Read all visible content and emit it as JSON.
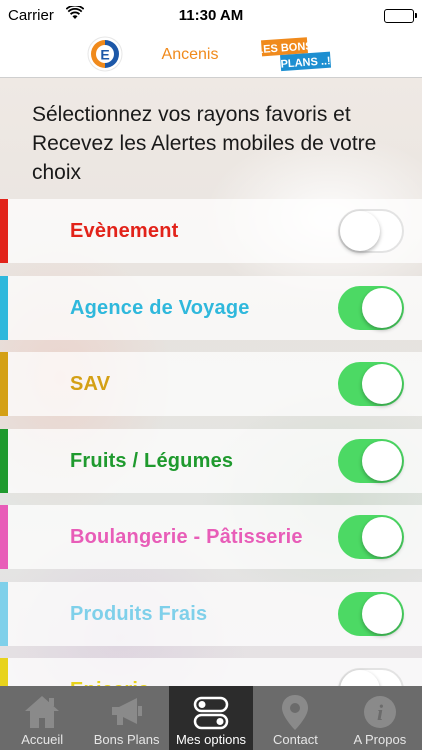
{
  "status_bar": {
    "carrier": "Carrier",
    "time": "11:30 AM"
  },
  "header": {
    "store_name": "Ancenis",
    "logo_icon": "leclerc-e-logo",
    "bons_plans_logo_text": "LES BONS PLANS ..!"
  },
  "intro_text": "Sélectionnez vos rayons favoris et Recevez les Alertes mobiles de votre choix",
  "rows": [
    {
      "label": "Evènement",
      "color": "#e2231a",
      "enabled": false
    },
    {
      "label": "Agence de Voyage",
      "color": "#2fb8dc",
      "enabled": true
    },
    {
      "label": "SAV",
      "color": "#d4a015",
      "enabled": true
    },
    {
      "label": "Fruits / Légumes",
      "color": "#1f9a2e",
      "enabled": true
    },
    {
      "label": "Boulangerie - Pâtisserie",
      "color": "#e85db8",
      "enabled": true
    },
    {
      "label": "Produits Frais",
      "color": "#7fd0ea",
      "enabled": true
    },
    {
      "label": "Epicerie",
      "color": "#e8d31c",
      "enabled": false
    }
  ],
  "tabs": [
    {
      "label": "Accueil",
      "icon": "home-icon",
      "active": false
    },
    {
      "label": "Bons Plans",
      "icon": "megaphone-icon",
      "active": false
    },
    {
      "label": "Mes options",
      "icon": "toggles-icon",
      "active": true
    },
    {
      "label": "Contact",
      "icon": "location-pin-icon",
      "active": false
    },
    {
      "label": "A Propos",
      "icon": "info-icon",
      "active": false
    }
  ],
  "colors": {
    "accent_orange": "#f08a1c",
    "toggle_on": "#4cd964",
    "tabbar_bg": "#6b6b6b",
    "tab_active_bg": "#2c2c2c"
  }
}
